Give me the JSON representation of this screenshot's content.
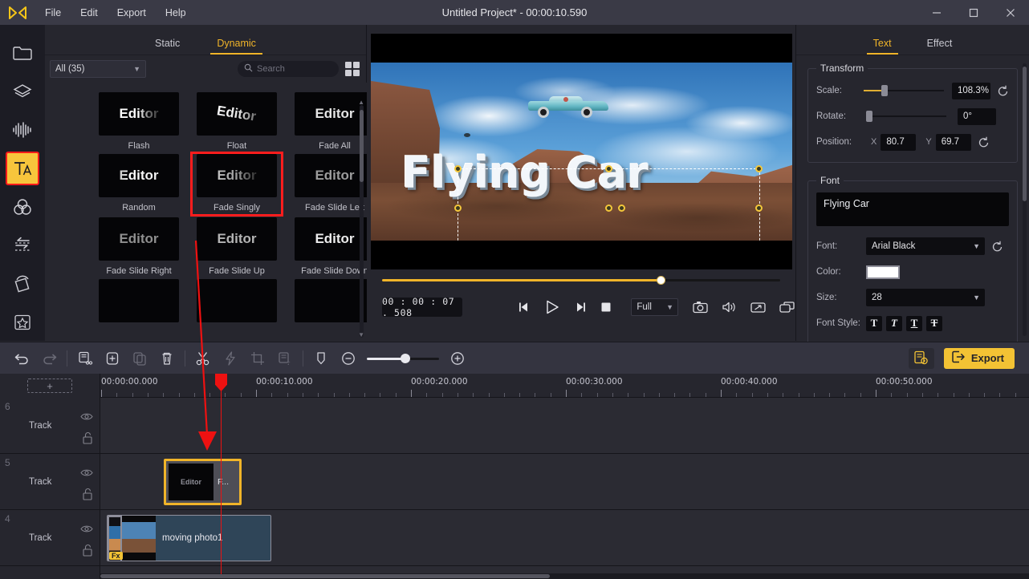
{
  "titlebar": {
    "logo": "logo-icon",
    "menus": [
      "File",
      "Edit",
      "Export",
      "Help"
    ],
    "title": "Untitled Project* - 00:00:10.590",
    "minimize": "–",
    "maximize": "❐",
    "close": "✕"
  },
  "rail": {
    "items": [
      {
        "name": "media-library",
        "icon": "folder-icon"
      },
      {
        "name": "layers",
        "icon": "stack-icon"
      },
      {
        "name": "audio",
        "icon": "waveform-icon"
      },
      {
        "name": "text",
        "icon": "text-icon",
        "active": true
      },
      {
        "name": "filters",
        "icon": "color-circles-icon"
      },
      {
        "name": "transitions",
        "icon": "transition-arrows-icon"
      },
      {
        "name": "motion",
        "icon": "rotate-square-icon"
      },
      {
        "name": "favorites",
        "icon": "star-icon"
      }
    ]
  },
  "effects": {
    "tabs": [
      {
        "label": "Static",
        "active": false
      },
      {
        "label": "Dynamic",
        "active": true
      }
    ],
    "filter_value": "All (35)",
    "search_placeholder": "Search",
    "grid_toggle": "grid-view-icon",
    "items": [
      {
        "label": "Flash",
        "preview": "Editor",
        "style": "flash",
        "selected": false
      },
      {
        "label": "Float",
        "preview": "Editor",
        "style": "float",
        "selected": false
      },
      {
        "label": "Fade All",
        "preview": "Editor",
        "style": "plain",
        "selected": false
      },
      {
        "label": "Random",
        "preview": "Editor",
        "style": "random",
        "selected": false
      },
      {
        "label": "Fade Singly",
        "preview": "Editor",
        "style": "fadeout",
        "selected": true
      },
      {
        "label": "Fade Slide Left",
        "preview": "Editor",
        "style": "dim",
        "selected": false
      },
      {
        "label": "Fade Slide Right",
        "preview": "Editor",
        "style": "dim",
        "selected": false
      },
      {
        "label": "Fade Slide Up",
        "preview": "Editor",
        "style": "dim",
        "selected": false
      },
      {
        "label": "Fade Slide Down",
        "preview": "Editor",
        "style": "plain",
        "selected": false
      }
    ]
  },
  "preview": {
    "title_text": "Flying Car",
    "timecode": "00 : 00 : 07 . 508",
    "quality": "Full",
    "transport": {
      "prev_frame": "previous-frame-icon",
      "play": "play-icon",
      "next_frame": "next-frame-icon",
      "stop": "stop-icon"
    },
    "tools": {
      "snapshot": "camera-icon",
      "volume": "speaker-icon",
      "fullscreen": "expand-icon",
      "popout": "detach-window-icon"
    }
  },
  "properties": {
    "tabs": [
      {
        "label": "Text",
        "active": true
      },
      {
        "label": "Effect",
        "active": false
      }
    ],
    "transform": {
      "title": "Transform",
      "scale_label": "Scale:",
      "scale_value": "108.3%",
      "rotate_label": "Rotate:",
      "rotate_value": "0°",
      "position_label": "Position:",
      "x_label": "X",
      "x_value": "80.7",
      "y_label": "Y",
      "y_value": "69.7",
      "reset_icon": "reset-icon"
    },
    "font": {
      "title": "Font",
      "text_value": "Flying Car",
      "font_label": "Font:",
      "font_value": "Arial Black",
      "color_label": "Color:",
      "color_value": "#ffffff",
      "size_label": "Size:",
      "size_value": "28",
      "style_label": "Font Style:",
      "style_buttons": [
        "T",
        "T",
        "T",
        "T"
      ]
    }
  },
  "toolbar": {
    "undo": "undo-icon",
    "redo": "redo-icon",
    "crop_split": "split-clip-icon",
    "add_clip": "add-clip-icon",
    "copy": "duplicate-icon",
    "delete": "trash-icon",
    "cut": "scissors-icon",
    "speed": "lightning-icon",
    "crop": "crop-icon",
    "detach_audio": "detach-audio-icon",
    "marker": "marker-icon",
    "zoom_out": "zoom-out-icon",
    "zoom_in": "zoom-in-icon",
    "settings": "project-settings-icon",
    "export_label": "Export",
    "export_icon": "export-icon"
  },
  "timeline": {
    "add_track_label": "+",
    "ruler_labels": [
      "00:00:00.000",
      "00:00:10.000",
      "00:00:20.000",
      "00:00:30.000",
      "00:00:40.000",
      "00:00:50.000"
    ],
    "tracks": [
      {
        "number": "6",
        "name": "Track",
        "eye": "eye-icon",
        "lock": "unlock-icon"
      },
      {
        "number": "5",
        "name": "Track",
        "eye": "eye-icon",
        "lock": "unlock-icon"
      },
      {
        "number": "4",
        "name": "Track",
        "eye": "eye-icon",
        "lock": "unlock-icon"
      }
    ],
    "clip_text": {
      "thumb_label": "Editor",
      "name": "F..."
    },
    "clip_media": {
      "name": "moving photo1",
      "badge": "Fx"
    }
  }
}
